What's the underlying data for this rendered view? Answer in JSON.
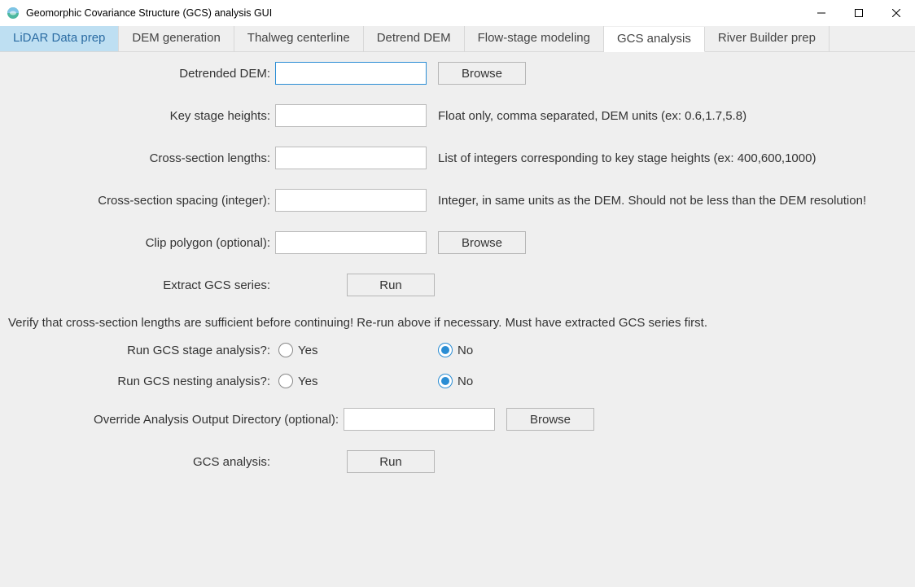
{
  "window": {
    "title": "Geomorphic Covariance Structure (GCS) analysis GUI"
  },
  "tabs": [
    {
      "label": "LiDAR Data prep"
    },
    {
      "label": "DEM generation"
    },
    {
      "label": "Thalweg centerline"
    },
    {
      "label": "Detrend DEM"
    },
    {
      "label": "Flow-stage modeling"
    },
    {
      "label": "GCS analysis"
    },
    {
      "label": "River Builder prep"
    }
  ],
  "form": {
    "detrended_dem": {
      "label": "Detrended DEM:",
      "value": "",
      "browse": "Browse"
    },
    "key_stage": {
      "label": "Key stage heights:",
      "value": "",
      "hint": "Float only, comma separated, DEM units (ex: 0.6,1.7,5.8)"
    },
    "xs_lengths": {
      "label": "Cross-section lengths:",
      "value": "",
      "hint": "List of integers corresponding to key stage heights (ex: 400,600,1000)"
    },
    "xs_spacing": {
      "label": "Cross-section spacing (integer):",
      "value": "",
      "hint": "Integer, in same units as the DEM. Should not be less than the DEM resolution!"
    },
    "clip_poly": {
      "label": "Clip polygon (optional):",
      "value": "",
      "browse": "Browse"
    },
    "extract": {
      "label": "Extract GCS series:",
      "run": "Run"
    },
    "verify": "Verify that cross-section lengths are sufficient before continuing! Re-run above if necessary. Must have extracted GCS series first.",
    "stage_analysis": {
      "label": "Run GCS stage analysis?:",
      "yes": "Yes",
      "no": "No",
      "value": "No"
    },
    "nesting_analysis": {
      "label": "Run GCS nesting analysis?:",
      "yes": "Yes",
      "no": "No",
      "value": "No"
    },
    "override_out": {
      "label": "Override Analysis Output Directory (optional):",
      "value": "",
      "browse": "Browse"
    },
    "gcs_analysis": {
      "label": "GCS analysis:",
      "run": "Run"
    }
  }
}
